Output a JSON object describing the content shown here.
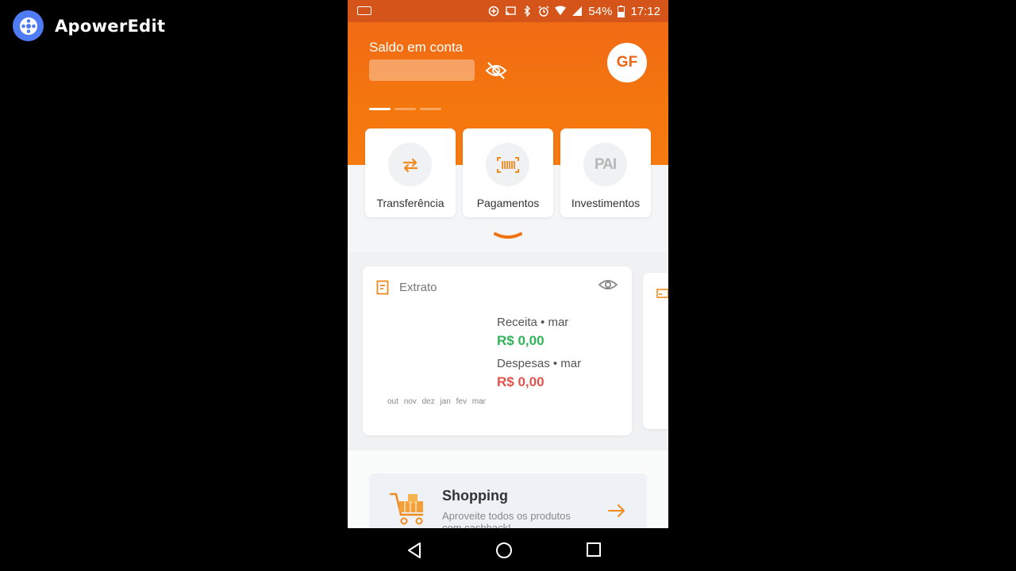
{
  "watermark": {
    "text": "ApowerEdit"
  },
  "statusbar": {
    "battery": "54%",
    "time": "17:12"
  },
  "header": {
    "balance_label": "Saldo em conta",
    "avatar_initials": "GF"
  },
  "actions": [
    {
      "label": "Transferência",
      "icon": "transfer-icon"
    },
    {
      "label": "Pagamentos",
      "icon": "barcode-icon"
    },
    {
      "label": "Investimentos",
      "icon": "pai-logo-icon",
      "icon_text": "PAI"
    }
  ],
  "extrato": {
    "title": "Extrato",
    "receita_label": "Receita • mar",
    "receita_value": "R$ 0,00",
    "despesas_label": "Despesas • mar",
    "despesas_value": "R$ 0,00",
    "months": [
      "out",
      "nov",
      "dez",
      "jan",
      "fev",
      "mar"
    ]
  },
  "shopping": {
    "title": "Shopping",
    "subtitle": "Aproveite todos os produtos com cashback!"
  },
  "colors": {
    "accent": "#f16a14",
    "positive": "#2fb45a",
    "negative": "#e5524c"
  }
}
